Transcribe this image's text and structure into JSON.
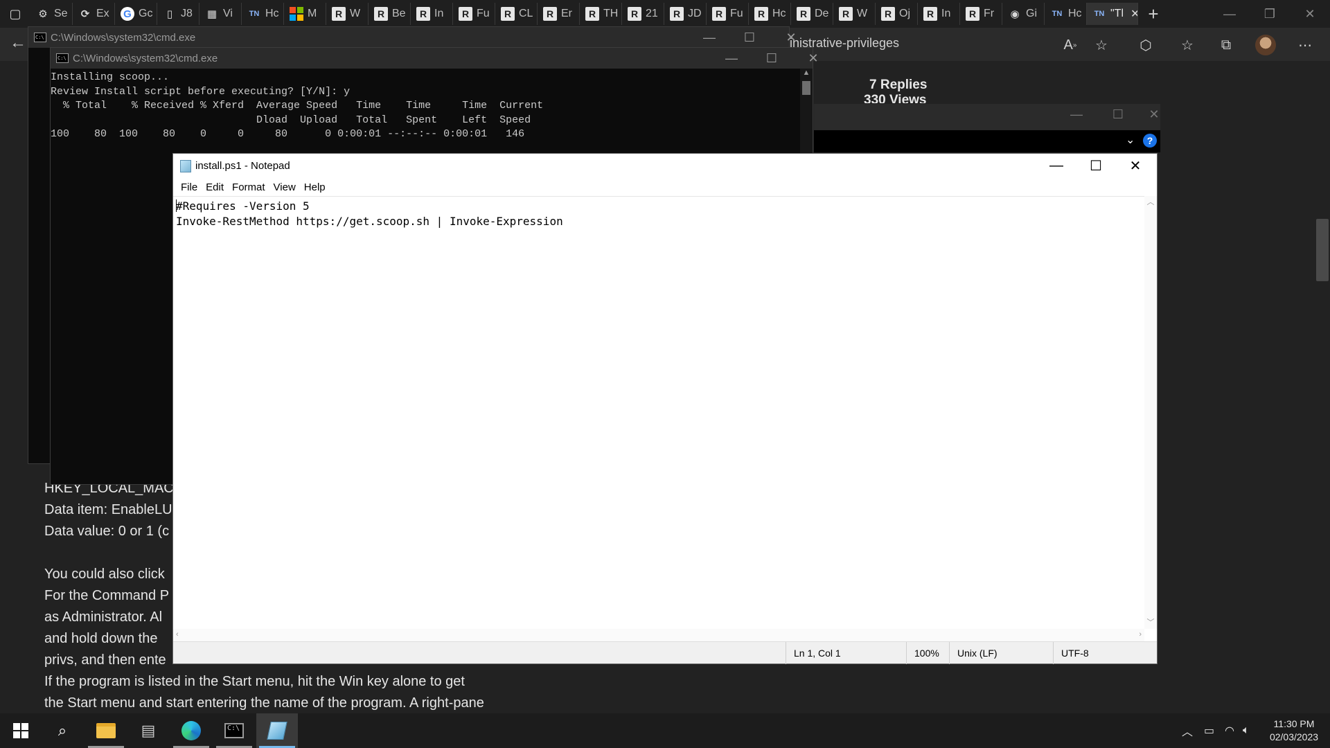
{
  "browser": {
    "tabs": [
      {
        "label": "Se",
        "icon": "gear-icon"
      },
      {
        "label": "Ex",
        "icon": "extension-icon"
      },
      {
        "label": "Gc",
        "icon": "google-icon"
      },
      {
        "label": "J8",
        "icon": "document-icon"
      },
      {
        "label": "Vi",
        "icon": "image-icon"
      },
      {
        "label": "Hc",
        "icon": "tn-icon"
      },
      {
        "label": "M",
        "icon": "microsoft-icon"
      },
      {
        "label": "W",
        "icon": "r-icon"
      },
      {
        "label": "Be",
        "icon": "r-icon"
      },
      {
        "label": "In",
        "icon": "r-icon"
      },
      {
        "label": "Fu",
        "icon": "r-icon"
      },
      {
        "label": "CL",
        "icon": "r-icon"
      },
      {
        "label": "Er",
        "icon": "r-icon"
      },
      {
        "label": "TH",
        "icon": "r-icon"
      },
      {
        "label": "21",
        "icon": "r-icon"
      },
      {
        "label": "JD",
        "icon": "r-icon"
      },
      {
        "label": "Fu",
        "icon": "r-icon"
      },
      {
        "label": "Hc",
        "icon": "r-icon"
      },
      {
        "label": "De",
        "icon": "r-icon"
      },
      {
        "label": "W",
        "icon": "r-icon"
      },
      {
        "label": "Oj",
        "icon": "r-icon"
      },
      {
        "label": "In",
        "icon": "r-icon"
      },
      {
        "label": "Fr",
        "icon": "r-icon"
      },
      {
        "label": "Gi",
        "icon": "github-icon"
      },
      {
        "label": "Hc",
        "icon": "tn-icon"
      }
    ],
    "active_tab": "\"Tl",
    "url_fragment": "inistrative-privileges"
  },
  "webpage": {
    "replies": "7 Replies",
    "views": "330 Views",
    "article_lines": [
      "HKEY_LOCAL_MACH",
      "Data item: EnableLU",
      "Data value: 0 or 1 (c",
      "",
      "You could also click",
      "For the Command P",
      "as Administrator. Al",
      "and hold down the",
      "privs, and then ente",
      "If the program is listed in the Start menu, hit the Win key alone to get",
      "the Start menu and start entering the name of the program. A right-pane"
    ]
  },
  "cmd_back": {
    "title": "C:\\Windows\\system32\\cmd.exe"
  },
  "cmd_front": {
    "title": "C:\\Windows\\system32\\cmd.exe",
    "output": "Installing scoop...\nReview Install script before executing? [Y/N]: y\n  % Total    % Received % Xferd  Average Speed   Time    Time     Time  Current\n                                 Dload  Upload   Total   Spent    Left  Speed\n100    80  100    80    0     0     80      0 0:00:01 --:--:-- 0:00:01   146"
  },
  "notepad": {
    "title": "install.ps1 - Notepad",
    "menu": [
      "File",
      "Edit",
      "Format",
      "View",
      "Help"
    ],
    "line1": "#Requires -Version 5",
    "line2": "Invoke-RestMethod https://get.scoop.sh | Invoke-Expression",
    "status": {
      "position": "Ln 1, Col 1",
      "zoom": "100%",
      "line_ending": "Unix (LF)",
      "encoding": "UTF-8"
    }
  },
  "taskbar": {
    "time": "11:30 PM",
    "date": "02/03/2023"
  }
}
